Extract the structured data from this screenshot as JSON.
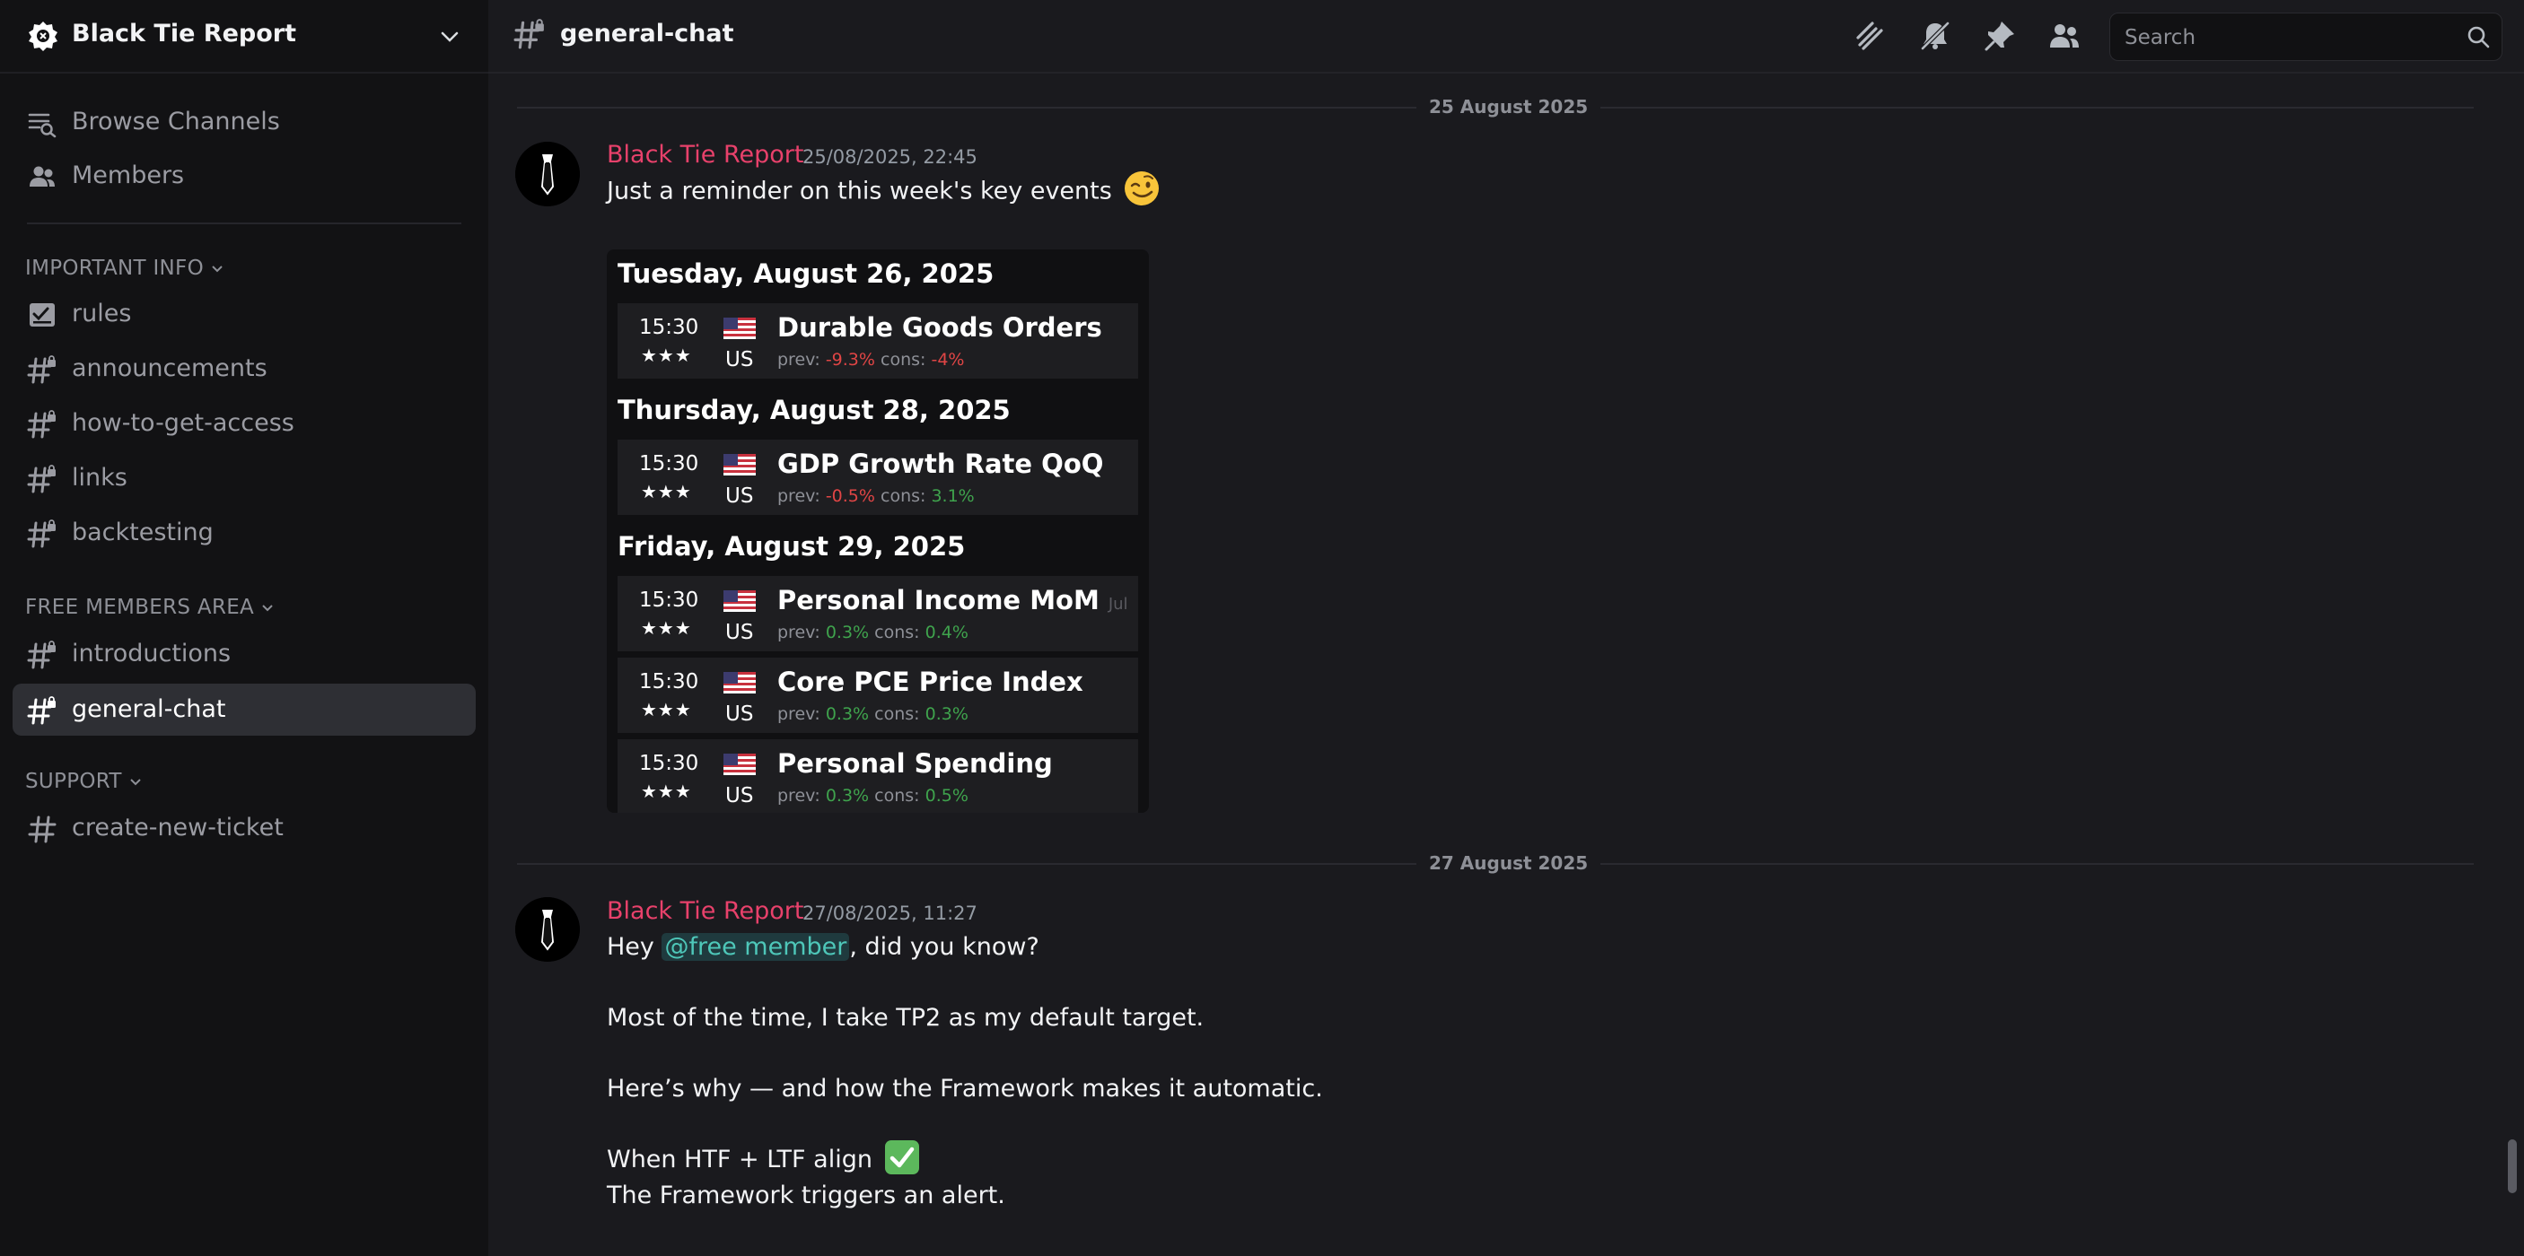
{
  "server": {
    "name": "Black Tie Report"
  },
  "sidebar": {
    "top_items": [
      {
        "label": "Browse Channels",
        "icon": "browse-channels-icon"
      },
      {
        "label": "Members",
        "icon": "members-icon"
      }
    ],
    "categories": [
      {
        "label": "IMPORTANT INFO",
        "channels": [
          "rules",
          "announcements",
          "how-to-get-access",
          "links",
          "backtesting"
        ]
      },
      {
        "label": "FREE MEMBERS AREA",
        "channels": [
          "introductions",
          "general-chat"
        ]
      },
      {
        "label": "SUPPORT",
        "channels": [
          "create-new-ticket"
        ]
      }
    ],
    "active_channel": "general-chat"
  },
  "header": {
    "channel": "general-chat",
    "icons": [
      "threads-icon",
      "notifications-muted-icon",
      "pin-icon",
      "member-list-icon"
    ],
    "search_placeholder": "Search"
  },
  "messages": [
    {
      "date_separator": "25 August 2025",
      "author": "Black Tie Report",
      "timestamp": "25/08/2025, 22:45",
      "text": "Just a reminder on this week's key events",
      "emoji": "winking-face",
      "calendar": [
        {
          "day": "Tuesday, August 26, 2025",
          "events": [
            {
              "time": "15:30",
              "stars": "★★★",
              "country": "US",
              "name": "Durable Goods Orders",
              "tag": "",
              "prev_label": "prev:",
              "prev": "-9.3%",
              "prev_dir": "neg",
              "cons_label": "cons:",
              "cons": "-4%",
              "cons_dir": "neg"
            }
          ]
        },
        {
          "day": "Thursday, August 28, 2025",
          "events": [
            {
              "time": "15:30",
              "stars": "★★★",
              "country": "US",
              "name": "GDP Growth Rate QoQ",
              "tag": "",
              "prev_label": "prev:",
              "prev": "-0.5%",
              "prev_dir": "neg",
              "cons_label": "cons:",
              "cons": "3.1%",
              "cons_dir": "pos"
            }
          ]
        },
        {
          "day": "Friday, August 29, 2025",
          "events": [
            {
              "time": "15:30",
              "stars": "★★★",
              "country": "US",
              "name": "Personal Income MoM",
              "tag": "Jul",
              "prev_label": "prev:",
              "prev": "0.3%",
              "prev_dir": "pos",
              "cons_label": "cons:",
              "cons": "0.4%",
              "cons_dir": "pos"
            },
            {
              "time": "15:30",
              "stars": "★★★",
              "country": "US",
              "name": "Core PCE Price Index",
              "tag": "",
              "prev_label": "prev:",
              "prev": "0.3%",
              "prev_dir": "pos",
              "cons_label": "cons:",
              "cons": "0.3%",
              "cons_dir": "pos"
            },
            {
              "time": "15:30",
              "stars": "★★★",
              "country": "US",
              "name": "Personal Spending",
              "tag": "",
              "prev_label": "prev:",
              "prev": "0.3%",
              "prev_dir": "pos",
              "cons_label": "cons:",
              "cons": "0.5%",
              "cons_dir": "pos"
            }
          ]
        }
      ]
    },
    {
      "date_separator": "27 August 2025",
      "author": "Black Tie Report",
      "timestamp": "27/08/2025, 11:27",
      "line1_prefix": "Hey ",
      "mention": "@free member",
      "line1_suffix": ", did you know?",
      "line2": "Most of the time, I take TP2 as my default target.",
      "line3": "Here’s why — and how the Framework makes it automatic.",
      "line4": "When HTF + LTF align",
      "line4_emoji": "check-mark-button",
      "line5": "The Framework triggers an alert."
    }
  ],
  "colors": {
    "author": "#e8416b",
    "mention": "#4ec7b9",
    "negative": "#e04545",
    "positive": "#3fa34d"
  }
}
